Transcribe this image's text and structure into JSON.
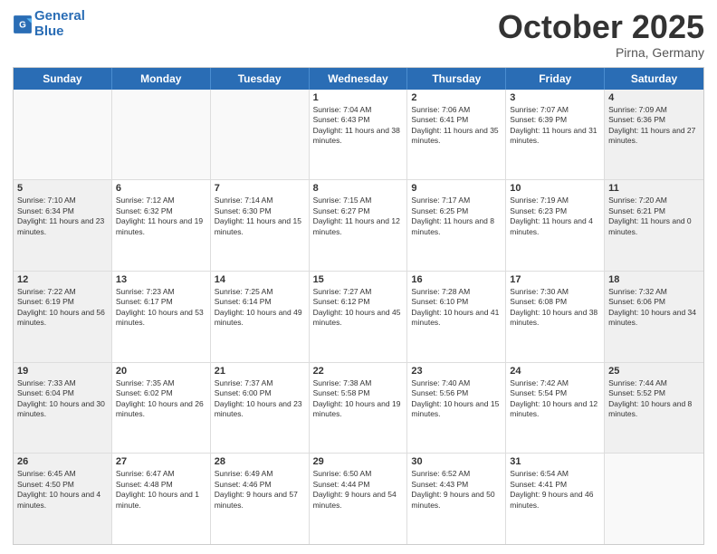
{
  "header": {
    "logo_line1": "General",
    "logo_line2": "Blue",
    "month": "October 2025",
    "location": "Pirna, Germany"
  },
  "weekdays": [
    "Sunday",
    "Monday",
    "Tuesday",
    "Wednesday",
    "Thursday",
    "Friday",
    "Saturday"
  ],
  "rows": [
    [
      {
        "day": "",
        "sunrise": "",
        "sunset": "",
        "daylight": ""
      },
      {
        "day": "",
        "sunrise": "",
        "sunset": "",
        "daylight": ""
      },
      {
        "day": "",
        "sunrise": "",
        "sunset": "",
        "daylight": ""
      },
      {
        "day": "1",
        "sunrise": "Sunrise: 7:04 AM",
        "sunset": "Sunset: 6:43 PM",
        "daylight": "Daylight: 11 hours and 38 minutes."
      },
      {
        "day": "2",
        "sunrise": "Sunrise: 7:06 AM",
        "sunset": "Sunset: 6:41 PM",
        "daylight": "Daylight: 11 hours and 35 minutes."
      },
      {
        "day": "3",
        "sunrise": "Sunrise: 7:07 AM",
        "sunset": "Sunset: 6:39 PM",
        "daylight": "Daylight: 11 hours and 31 minutes."
      },
      {
        "day": "4",
        "sunrise": "Sunrise: 7:09 AM",
        "sunset": "Sunset: 6:36 PM",
        "daylight": "Daylight: 11 hours and 27 minutes."
      }
    ],
    [
      {
        "day": "5",
        "sunrise": "Sunrise: 7:10 AM",
        "sunset": "Sunset: 6:34 PM",
        "daylight": "Daylight: 11 hours and 23 minutes."
      },
      {
        "day": "6",
        "sunrise": "Sunrise: 7:12 AM",
        "sunset": "Sunset: 6:32 PM",
        "daylight": "Daylight: 11 hours and 19 minutes."
      },
      {
        "day": "7",
        "sunrise": "Sunrise: 7:14 AM",
        "sunset": "Sunset: 6:30 PM",
        "daylight": "Daylight: 11 hours and 15 minutes."
      },
      {
        "day": "8",
        "sunrise": "Sunrise: 7:15 AM",
        "sunset": "Sunset: 6:27 PM",
        "daylight": "Daylight: 11 hours and 12 minutes."
      },
      {
        "day": "9",
        "sunrise": "Sunrise: 7:17 AM",
        "sunset": "Sunset: 6:25 PM",
        "daylight": "Daylight: 11 hours and 8 minutes."
      },
      {
        "day": "10",
        "sunrise": "Sunrise: 7:19 AM",
        "sunset": "Sunset: 6:23 PM",
        "daylight": "Daylight: 11 hours and 4 minutes."
      },
      {
        "day": "11",
        "sunrise": "Sunrise: 7:20 AM",
        "sunset": "Sunset: 6:21 PM",
        "daylight": "Daylight: 11 hours and 0 minutes."
      }
    ],
    [
      {
        "day": "12",
        "sunrise": "Sunrise: 7:22 AM",
        "sunset": "Sunset: 6:19 PM",
        "daylight": "Daylight: 10 hours and 56 minutes."
      },
      {
        "day": "13",
        "sunrise": "Sunrise: 7:23 AM",
        "sunset": "Sunset: 6:17 PM",
        "daylight": "Daylight: 10 hours and 53 minutes."
      },
      {
        "day": "14",
        "sunrise": "Sunrise: 7:25 AM",
        "sunset": "Sunset: 6:14 PM",
        "daylight": "Daylight: 10 hours and 49 minutes."
      },
      {
        "day": "15",
        "sunrise": "Sunrise: 7:27 AM",
        "sunset": "Sunset: 6:12 PM",
        "daylight": "Daylight: 10 hours and 45 minutes."
      },
      {
        "day": "16",
        "sunrise": "Sunrise: 7:28 AM",
        "sunset": "Sunset: 6:10 PM",
        "daylight": "Daylight: 10 hours and 41 minutes."
      },
      {
        "day": "17",
        "sunrise": "Sunrise: 7:30 AM",
        "sunset": "Sunset: 6:08 PM",
        "daylight": "Daylight: 10 hours and 38 minutes."
      },
      {
        "day": "18",
        "sunrise": "Sunrise: 7:32 AM",
        "sunset": "Sunset: 6:06 PM",
        "daylight": "Daylight: 10 hours and 34 minutes."
      }
    ],
    [
      {
        "day": "19",
        "sunrise": "Sunrise: 7:33 AM",
        "sunset": "Sunset: 6:04 PM",
        "daylight": "Daylight: 10 hours and 30 minutes."
      },
      {
        "day": "20",
        "sunrise": "Sunrise: 7:35 AM",
        "sunset": "Sunset: 6:02 PM",
        "daylight": "Daylight: 10 hours and 26 minutes."
      },
      {
        "day": "21",
        "sunrise": "Sunrise: 7:37 AM",
        "sunset": "Sunset: 6:00 PM",
        "daylight": "Daylight: 10 hours and 23 minutes."
      },
      {
        "day": "22",
        "sunrise": "Sunrise: 7:38 AM",
        "sunset": "Sunset: 5:58 PM",
        "daylight": "Daylight: 10 hours and 19 minutes."
      },
      {
        "day": "23",
        "sunrise": "Sunrise: 7:40 AM",
        "sunset": "Sunset: 5:56 PM",
        "daylight": "Daylight: 10 hours and 15 minutes."
      },
      {
        "day": "24",
        "sunrise": "Sunrise: 7:42 AM",
        "sunset": "Sunset: 5:54 PM",
        "daylight": "Daylight: 10 hours and 12 minutes."
      },
      {
        "day": "25",
        "sunrise": "Sunrise: 7:44 AM",
        "sunset": "Sunset: 5:52 PM",
        "daylight": "Daylight: 10 hours and 8 minutes."
      }
    ],
    [
      {
        "day": "26",
        "sunrise": "Sunrise: 6:45 AM",
        "sunset": "Sunset: 4:50 PM",
        "daylight": "Daylight: 10 hours and 4 minutes."
      },
      {
        "day": "27",
        "sunrise": "Sunrise: 6:47 AM",
        "sunset": "Sunset: 4:48 PM",
        "daylight": "Daylight: 10 hours and 1 minute."
      },
      {
        "day": "28",
        "sunrise": "Sunrise: 6:49 AM",
        "sunset": "Sunset: 4:46 PM",
        "daylight": "Daylight: 9 hours and 57 minutes."
      },
      {
        "day": "29",
        "sunrise": "Sunrise: 6:50 AM",
        "sunset": "Sunset: 4:44 PM",
        "daylight": "Daylight: 9 hours and 54 minutes."
      },
      {
        "day": "30",
        "sunrise": "Sunrise: 6:52 AM",
        "sunset": "Sunset: 4:43 PM",
        "daylight": "Daylight: 9 hours and 50 minutes."
      },
      {
        "day": "31",
        "sunrise": "Sunrise: 6:54 AM",
        "sunset": "Sunset: 4:41 PM",
        "daylight": "Daylight: 9 hours and 46 minutes."
      },
      {
        "day": "",
        "sunrise": "",
        "sunset": "",
        "daylight": ""
      }
    ]
  ]
}
